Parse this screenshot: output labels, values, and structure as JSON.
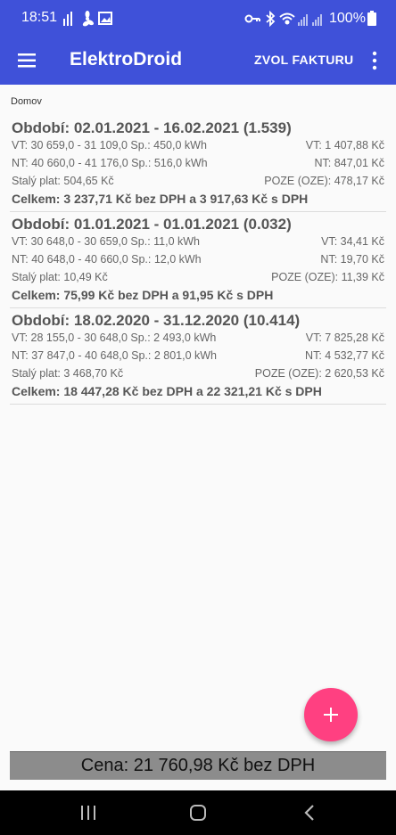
{
  "status_bar": {
    "time": "18:51",
    "battery": "100%",
    "left_icons": [
      "signal-bars-icon",
      "fan-icon",
      "image-icon"
    ],
    "right_icons": [
      "vpn-key-icon",
      "bluetooth-icon",
      "wifi-icon",
      "signal-icon",
      "signal-icon-2"
    ]
  },
  "app_bar": {
    "title": "ElektroDroid",
    "action": "ZVOL FAKTURU",
    "color": "#3f51d9"
  },
  "breadcrumb": "Domov",
  "invoices": [
    {
      "title": "Období: 02.01.2021 - 16.02.2021 (1.539)",
      "vt": "VT: 30 659,0 - 31 109,0  Sp.: 450,0 kWh",
      "vt_price": "VT: 1 407,88 Kč",
      "nt": "NT: 40 660,0 - 41 176,0  Sp.: 516,0 kWh",
      "nt_price": "NT: 847,01 Kč",
      "fixed": "Stalý plat: 504,65 Kč",
      "poze": "POZE (OZE): 478,17 Kč",
      "total": "Celkem: 3 237,71 Kč bez DPH a 3 917,63 Kč s DPH"
    },
    {
      "title": "Období: 01.01.2021 - 01.01.2021 (0.032)",
      "vt": "VT: 30 648,0 - 30 659,0  Sp.: 11,0 kWh",
      "vt_price": "VT: 34,41 Kč",
      "nt": "NT: 40 648,0 - 40 660,0  Sp.: 12,0 kWh",
      "nt_price": "NT: 19,70 Kč",
      "fixed": "Stalý plat: 10,49 Kč",
      "poze": "POZE (OZE): 11,39 Kč",
      "total": "Celkem: 75,99 Kč bez DPH a 91,95 Kč s DPH"
    },
    {
      "title": "Období: 18.02.2020 - 31.12.2020 (10.414)",
      "vt": "VT: 28 155,0 - 30 648,0  Sp.: 2 493,0 kWh",
      "vt_price": "VT: 7 825,28 Kč",
      "nt": "NT: 37 847,0 - 40 648,0  Sp.: 2 801,0 kWh",
      "nt_price": "NT: 4 532,77 Kč",
      "fixed": "Stalý plat: 3 468,70 Kč",
      "poze": "POZE (OZE): 2 620,53 Kč",
      "total": "Celkem: 18 447,28 Kč bez DPH a 22 321,21 Kč s DPH"
    }
  ],
  "fab": {
    "icon": "plus-icon",
    "color": "#ff4081"
  },
  "price_bar": "Cena: 21 760,98 Kč bez DPH",
  "nav_bar": {
    "buttons": [
      "recent-apps-icon",
      "home-icon",
      "back-icon"
    ]
  }
}
